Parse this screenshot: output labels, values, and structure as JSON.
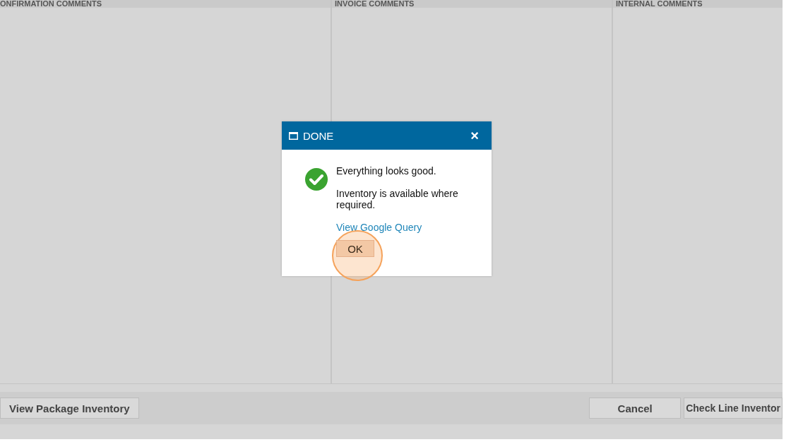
{
  "columns": [
    {
      "heading": "ONFIRMATION COMMENTS"
    },
    {
      "heading": "INVOICE COMMENTS"
    },
    {
      "heading": "INTERNAL COMMENTS"
    }
  ],
  "footer": {
    "left_buttons": [
      "View Package Inventory"
    ],
    "right_buttons": [
      "Cancel",
      "Check Line Inventor"
    ]
  },
  "dialog": {
    "title": "DONE",
    "close": "×",
    "messages": [
      "Everything looks good.",
      "Inventory is available where required."
    ],
    "link": "View Google Query",
    "button": "OK"
  }
}
